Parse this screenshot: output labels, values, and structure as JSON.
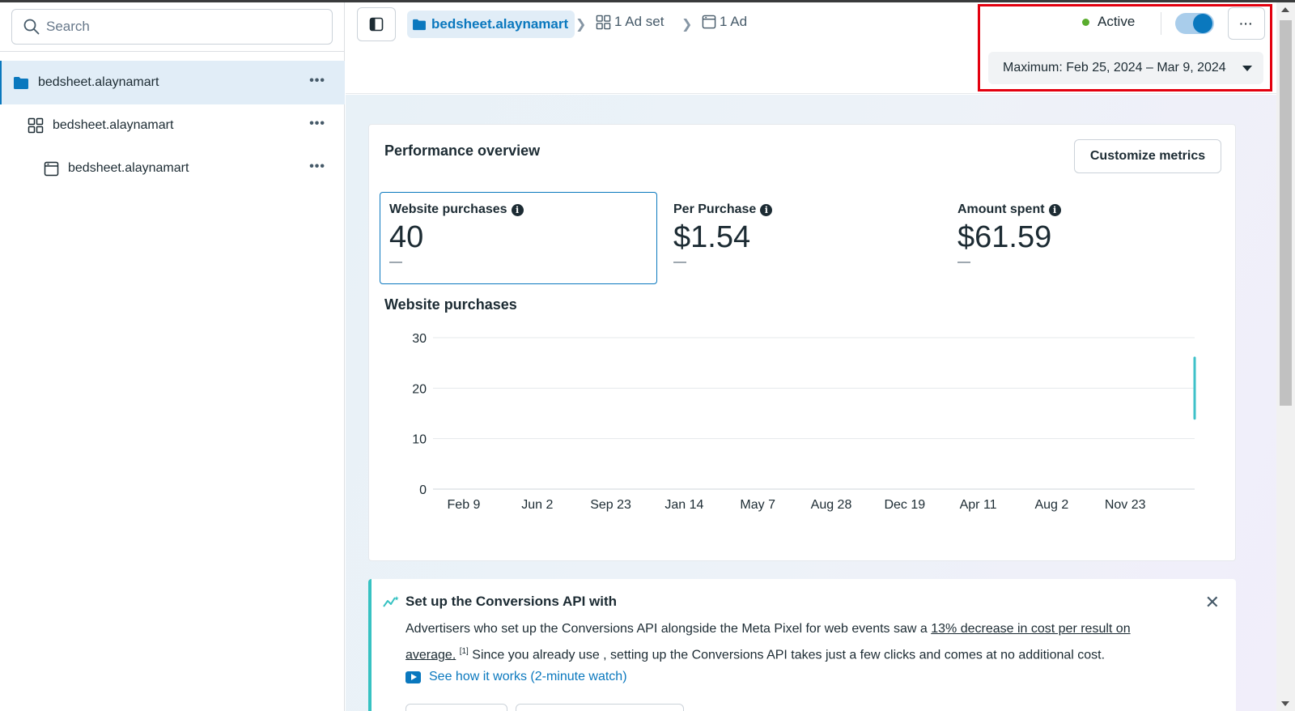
{
  "search": {
    "placeholder": "Search"
  },
  "sidebar": {
    "items": [
      {
        "label": "bedsheet.alaynamart",
        "more": "•••"
      },
      {
        "label": "bedsheet.alaynamart",
        "more": "•••"
      },
      {
        "label": "bedsheet.alaynamart",
        "more": "•••"
      }
    ]
  },
  "breadcrumb": {
    "campaign": "bedsheet.alaynamart",
    "adset": "1 Ad set",
    "ad": "1 Ad"
  },
  "status": {
    "label": "Active",
    "color": "#5aad2e",
    "toggle_on": true
  },
  "more_button": "···",
  "date_range": "Maximum: Feb 25, 2024 – Mar 9, 2024",
  "performance": {
    "title": "Performance overview",
    "customize_label": "Customize metrics",
    "metrics": [
      {
        "label": "Website purchases",
        "value": "40",
        "change": "—"
      },
      {
        "label": "Per Purchase",
        "value": "$1.54",
        "change": "—"
      },
      {
        "label": "Amount spent",
        "value": "$61.59",
        "change": "—"
      }
    ],
    "chart_title": "Website purchases"
  },
  "chart_data": {
    "type": "line",
    "title": "Website purchases",
    "categories": [
      "Feb 9",
      "Jun 2",
      "Sep 23",
      "Jan 14",
      "May 7",
      "Aug 28",
      "Dec 19",
      "Apr 11",
      "Aug 2",
      "Nov 23"
    ],
    "ylim": [
      0,
      30
    ],
    "yticks": [
      0,
      10,
      20,
      30
    ],
    "series": [
      {
        "values": [
          null,
          null,
          null,
          null,
          null,
          null,
          null,
          null,
          null,
          null
        ],
        "tail_segment": [
          14,
          26
        ],
        "color": "#3ec1c9"
      }
    ],
    "grid": true
  },
  "conversions": {
    "title": "Set up the Conversions API with",
    "body_prefix": "Advertisers who set up the Conversions API alongside the Meta Pixel for web events saw a ",
    "body_link": "13% decrease in cost per result on average.",
    "body_sup": "[1]",
    "body_suffix": " Since you already use , setting up the Conversions API takes just a few clicks and comes at no additional cost.",
    "link_label": "See how it works (2-minute watch)",
    "close": "✕"
  },
  "colors": {
    "accent": "#0a78be",
    "highlight_box": "#e3000f",
    "teal": "#37c2c2"
  }
}
